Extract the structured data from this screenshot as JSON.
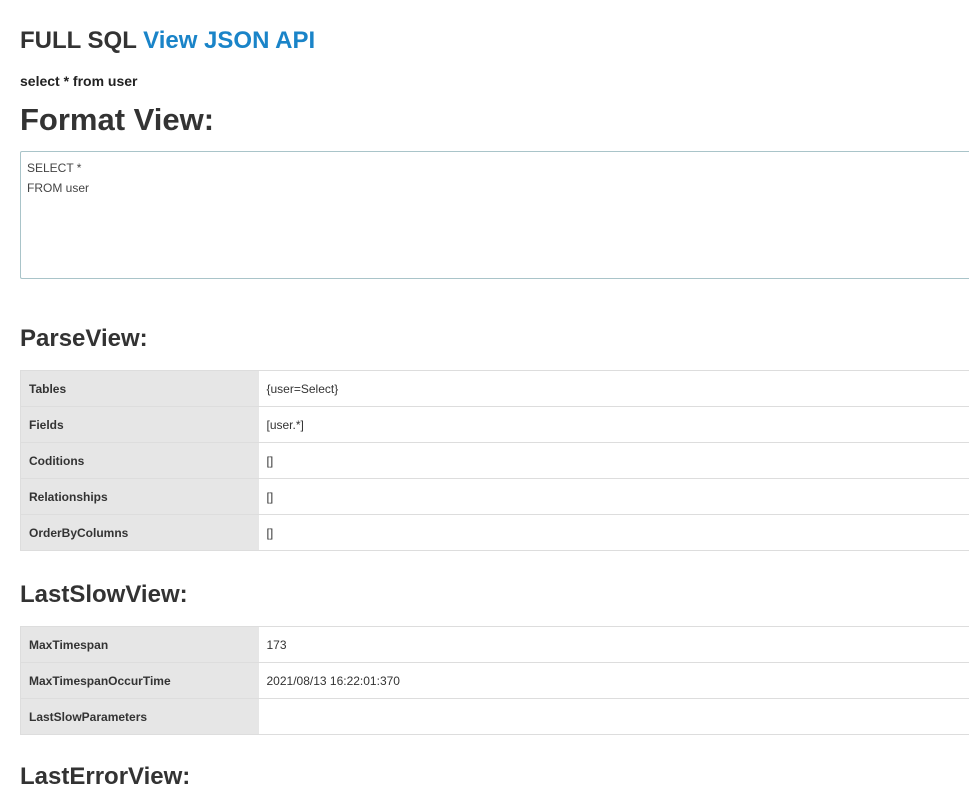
{
  "header": {
    "title_prefix": "FULL SQL",
    "view_json_link": "View JSON API"
  },
  "sql_text": "select * from user",
  "format_view": {
    "heading": "Format View:",
    "content": "SELECT *\nFROM user"
  },
  "parse_view": {
    "heading": "ParseView:",
    "rows": [
      {
        "key": "Tables",
        "value": "{user=Select}"
      },
      {
        "key": "Fields",
        "value": "[user.*]"
      },
      {
        "key": "Coditions",
        "value": "[]"
      },
      {
        "key": "Relationships",
        "value": "[]"
      },
      {
        "key": "OrderByColumns",
        "value": "[]"
      }
    ]
  },
  "last_slow_view": {
    "heading": "LastSlowView:",
    "rows": [
      {
        "key": "MaxTimespan",
        "value": "173"
      },
      {
        "key": "MaxTimespanOccurTime",
        "value": "2021/08/13 16:22:01:370"
      },
      {
        "key": "LastSlowParameters",
        "value": ""
      }
    ]
  },
  "last_error_view": {
    "heading": "LastErrorView:"
  }
}
